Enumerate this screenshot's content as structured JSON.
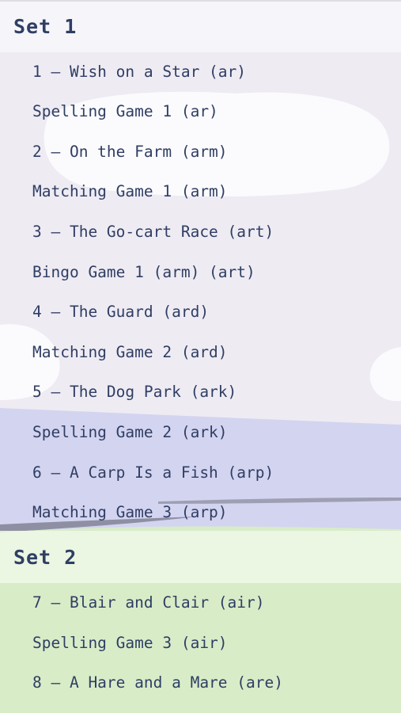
{
  "sets": [
    {
      "title": "Set 1",
      "items": [
        "1 — Wish on a Star (ar)",
        "Spelling Game 1 (ar)",
        "2 — On the Farm (arm)",
        "Matching Game 1 (arm)",
        "3 — The Go-cart Race (art)",
        "Bingo Game 1 (arm) (art)",
        "4 — The Guard (ard)",
        "Matching Game 2 (ard)",
        "5 — The Dog Park (ark)",
        "Spelling Game 2 (ark)",
        "6 — A Carp Is a Fish (arp)",
        "Matching Game 3 (arp)"
      ]
    },
    {
      "title": "Set 2",
      "items": [
        "7 — Blair and Clair (air)",
        "Spelling Game 3 (air)",
        "8 — A Hare and a Mare (are)"
      ]
    }
  ],
  "colors": {
    "text": "#2f3e63",
    "sky": "#eeebf3",
    "lake": "#d3d4f0",
    "grass": "#d8ecc8"
  }
}
